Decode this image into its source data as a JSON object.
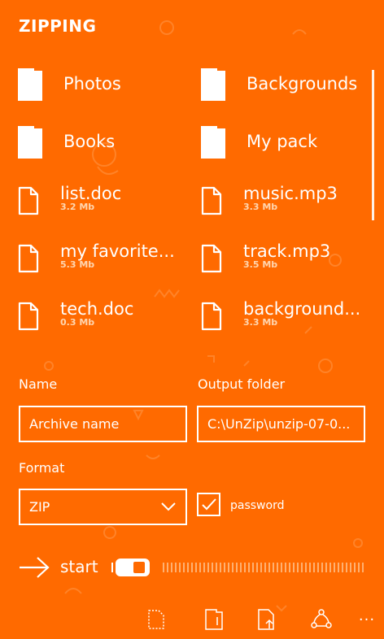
{
  "header": {
    "title": "ZIPPING"
  },
  "items": [
    {
      "type": "folder",
      "name": "Photos",
      "size": ""
    },
    {
      "type": "folder",
      "name": "Backgrounds",
      "size": ""
    },
    {
      "type": "folder",
      "name": "Books",
      "size": ""
    },
    {
      "type": "folder",
      "name": "My pack",
      "size": ""
    },
    {
      "type": "file",
      "name": "list.doc",
      "size": "3.2 Mb"
    },
    {
      "type": "file",
      "name": "music.mp3",
      "size": "3.3 Mb"
    },
    {
      "type": "file",
      "name": "my favorite...",
      "size": "5.3 Mb"
    },
    {
      "type": "file",
      "name": "track.mp3",
      "size": "3.5 Mb"
    },
    {
      "type": "file",
      "name": "tech.doc",
      "size": "0.3 Mb"
    },
    {
      "type": "file",
      "name": "background...",
      "size": "3.3 Mb"
    }
  ],
  "form": {
    "name_label": "Name",
    "name_value": "Archive name",
    "output_label": "Output folder",
    "output_value": "C:\\UnZip\\unzip-07-0...",
    "format_label": "Format",
    "format_value": "ZIP",
    "password_label": "password",
    "password_checked": true
  },
  "action": {
    "start_label": "start",
    "toggle_on": true,
    "progress": 0
  },
  "appbar": {
    "icons": [
      "new-file-icon",
      "add-folder-icon",
      "add-file-icon",
      "share-icon"
    ],
    "more_label": "..."
  },
  "colors": {
    "background": "#ff6a00",
    "foreground": "#ffffff",
    "size_text": "#ffd6b0"
  }
}
